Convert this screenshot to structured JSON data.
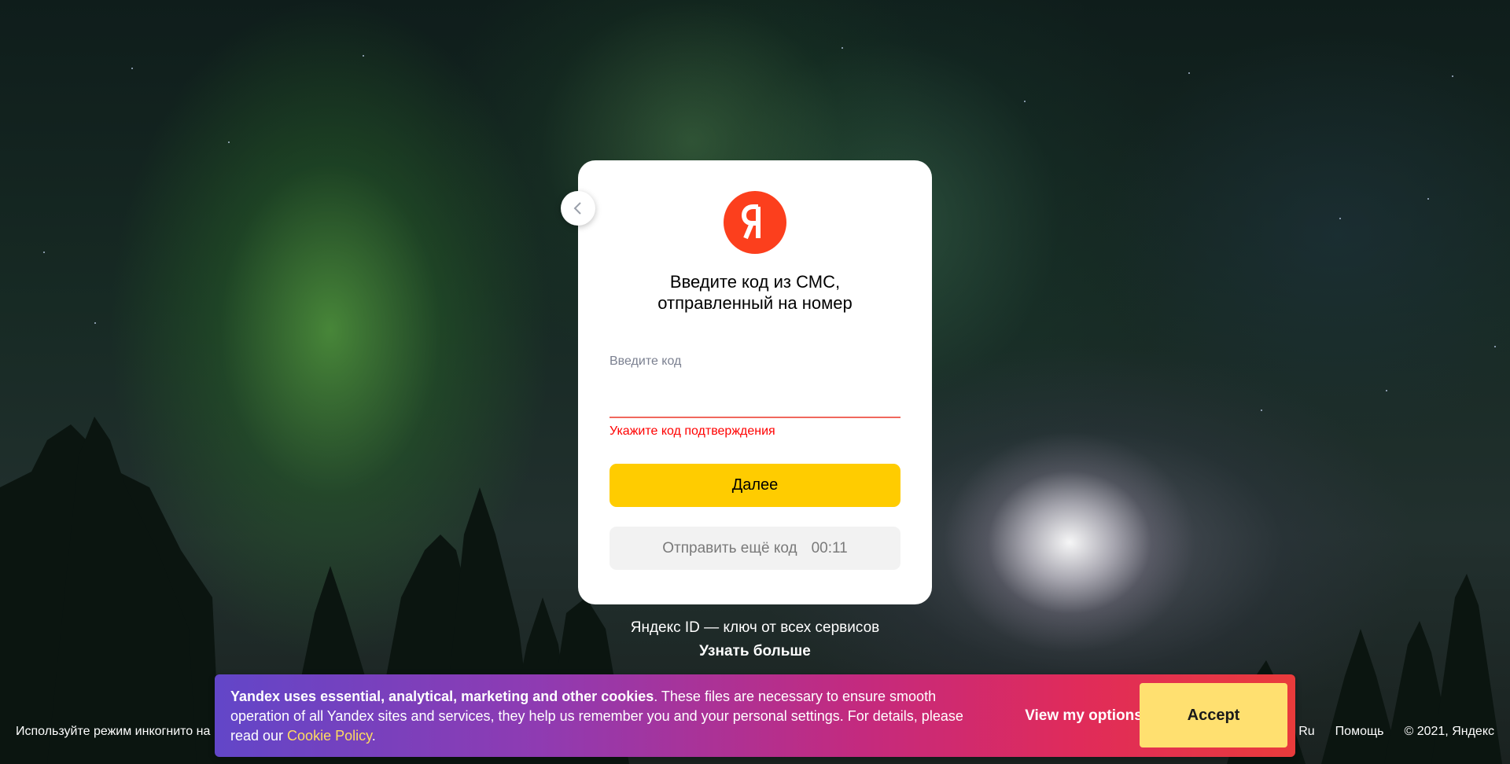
{
  "card": {
    "title_line1": "Введите код из СМС,",
    "title_line2": "отправленный на номер",
    "code_label": "Введите код",
    "code_value": "",
    "error": "Укажите код подтверждения",
    "next_button": "Далее",
    "resend_button": "Отправить ещё код",
    "resend_timer": "00:11"
  },
  "logo": {
    "letter": "Я",
    "color": "#fc3f1d"
  },
  "promo": {
    "text": "Яндекс ID — ключ от всех сервисов",
    "link": "Узнать больше"
  },
  "footer": {
    "incognito": "Используйте режим инкогнито на",
    "lang": "Ru",
    "help": "Помощь",
    "copyright": "© 2021, Яндекс"
  },
  "cookie": {
    "bold_text": "Yandex uses essential, analytical, marketing and other cookies",
    "text": ". These files are necessary to ensure smooth operation of all Yandex sites and services, they help us remember you and your personal settings. For details, please read our ",
    "link": "Cookie Policy",
    "after_link": ".",
    "view_options": "View my options",
    "accept": "Accept"
  },
  "colors": {
    "primary_button": "#ffcc00",
    "error": "#ff0000",
    "accept_button": "#ffe070"
  }
}
